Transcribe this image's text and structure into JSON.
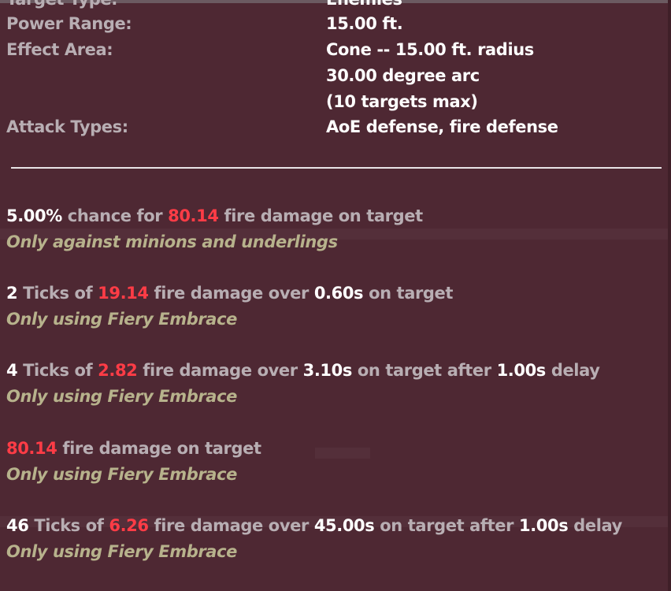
{
  "info": {
    "target_type_label": "Target Type:",
    "target_type_value": "Enemies",
    "power_range_label": "Power Range:",
    "power_range_value": "15.00 ft.",
    "effect_area_label": "Effect Area:",
    "effect_area_value_1": "Cone -- 15.00 ft. radius",
    "effect_area_value_2": "30.00 degree arc",
    "effect_area_value_3": "(10 targets max)",
    "attack_types_label": "Attack Types:",
    "attack_types_value": "AoE defense, fire defense"
  },
  "effects": [
    {
      "parts": [
        "5.00%",
        " chance for ",
        "80.14",
        " fire damage on target"
      ],
      "condition": "Only against minions and underlings"
    },
    {
      "parts": [
        "2",
        " Ticks of ",
        "19.14",
        " fire damage over ",
        "0.60s",
        " on target"
      ],
      "condition": "Only using Fiery Embrace"
    },
    {
      "parts": [
        "4",
        " Ticks of ",
        "2.82",
        " fire damage over ",
        "3.10s",
        " on target after ",
        "1.00s",
        " delay"
      ],
      "condition": "Only using Fiery Embrace"
    },
    {
      "parts": [
        "80.14",
        " fire damage on target"
      ],
      "condition": "Only using Fiery Embrace"
    },
    {
      "parts": [
        "46",
        " Ticks of ",
        "6.26",
        " fire damage over ",
        "45.00s",
        " on target after ",
        "1.00s",
        " delay"
      ],
      "condition": "Only using Fiery Embrace"
    }
  ],
  "colors": {
    "background": "#4e2833",
    "label": "#b8aeb3",
    "value": "#ffffff",
    "damage": "#ff3c46",
    "condition": "#b7b28c"
  }
}
